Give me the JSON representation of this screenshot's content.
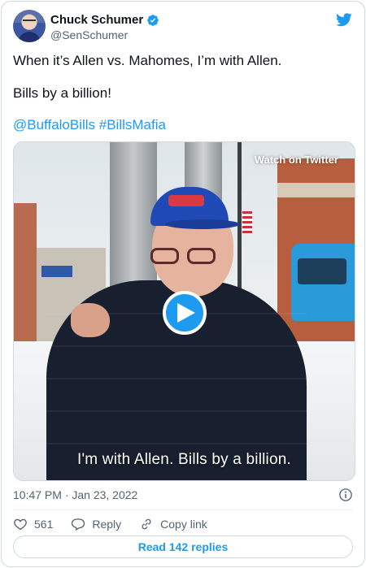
{
  "author": {
    "display_name": "Chuck Schumer",
    "handle": "@SenSchumer",
    "verified_icon": "verified-badge-icon"
  },
  "tweet": {
    "line1": "When it’s Allen vs. Mahomes, I’m with Allen.",
    "line2": "Bills by a billion!",
    "line3": "@BuffaloBills #BillsMafia"
  },
  "media": {
    "watch_label": "Watch on Twitter",
    "caption": "I'm with Allen. Bills by a billion."
  },
  "meta": {
    "timestamp": "10:47 PM · Jan 23, 2022"
  },
  "actions": {
    "like_count": "561",
    "reply_label": "Reply",
    "copy_link_label": "Copy link"
  },
  "footer": {
    "read_replies_label": "Read 142 replies"
  },
  "colors": {
    "accent": "#1d9bf0",
    "text": "#0f1419",
    "secondary": "#536471",
    "border": "#cfd9de"
  }
}
